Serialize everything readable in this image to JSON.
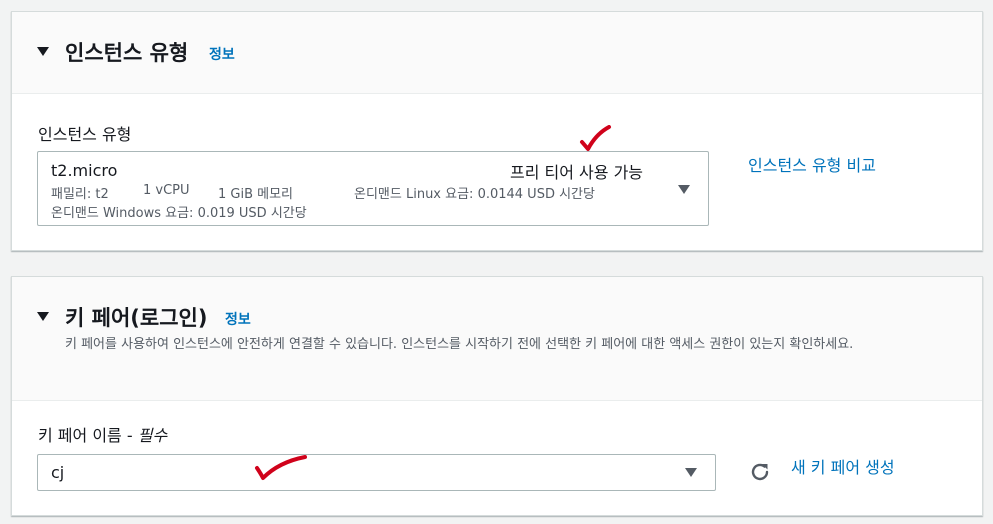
{
  "instance_section": {
    "title": "인스턴스 유형",
    "info": "정보",
    "field_label": "인스턴스 유형",
    "selected": {
      "name": "t2.micro",
      "badge": "프리 티어 사용 가능",
      "family": "패밀리: t2",
      "vcpu": "1 vCPU",
      "memory": "1 GiB 메모리",
      "linux_price": "온디맨드 Linux 요금: 0.0144 USD 시간당",
      "windows_price": "온디맨드 Windows 요금: 0.019 USD 시간당"
    },
    "compare_link": "인스턴스 유형 비교"
  },
  "keypair_section": {
    "title": "키 페어(로그인)",
    "info": "정보",
    "description": "키 페어를 사용하여 인스턴스에 안전하게 연결할 수 있습니다. 인스턴스를 시작하기 전에 선택한 키 페어에 대한 액세스 권한이 있는지 확인하세요.",
    "field_label": "키 페어 이름 - ",
    "field_required": "필수",
    "selected": "cj",
    "create_link": "새 키 페어 생성"
  },
  "colors": {
    "link": "#0073bb",
    "annotation": "#d0021b",
    "border": "#aab7b8"
  },
  "icons": {
    "collapse": "caret-down-icon",
    "dropdown": "dropdown-arrow-icon",
    "refresh": "refresh-icon",
    "annotation": "red-checkmark-icon"
  }
}
